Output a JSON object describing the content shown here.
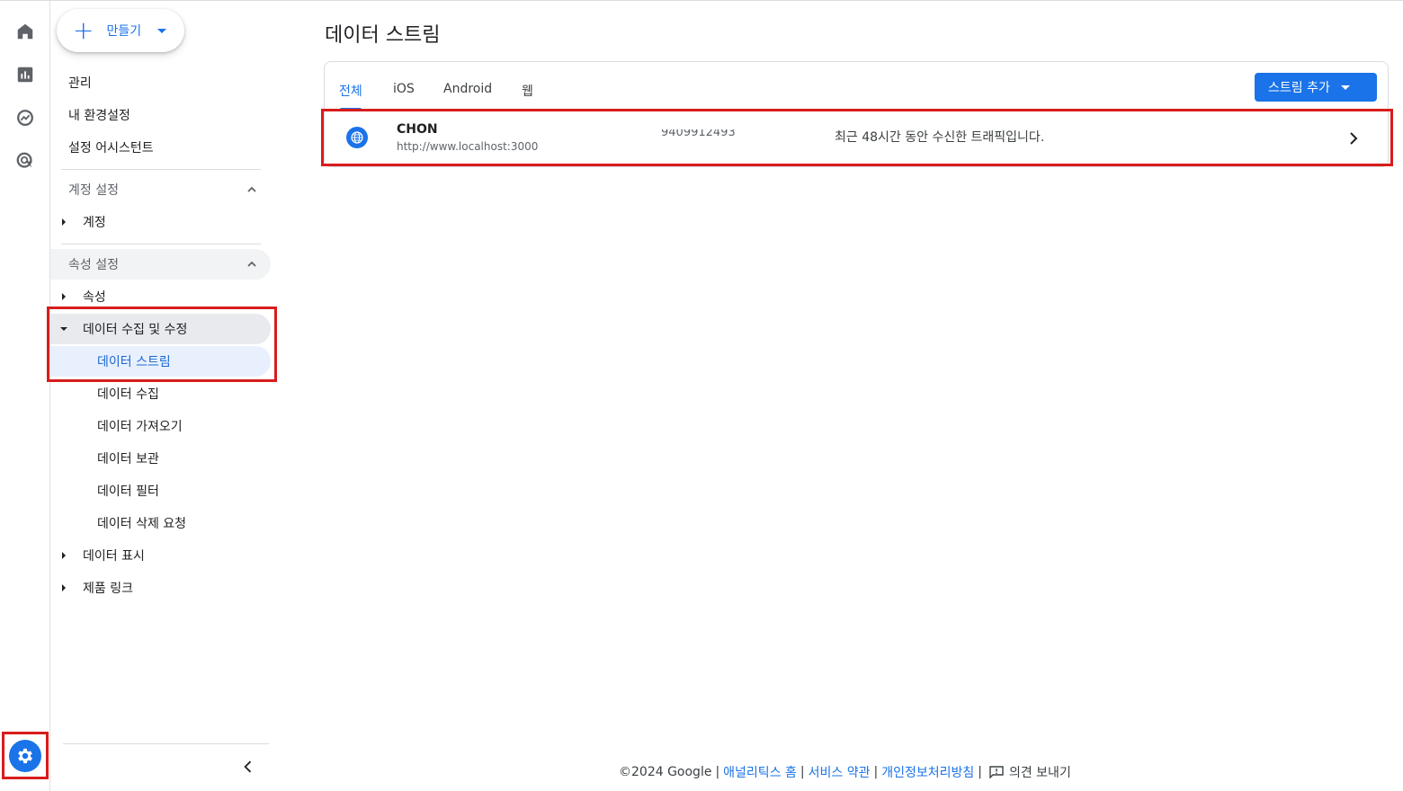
{
  "rail": {
    "icons": [
      "home-icon",
      "reports-icon",
      "explore-icon",
      "advertising-icon",
      "settings-icon"
    ]
  },
  "nav": {
    "create_label": "만들기",
    "admin": "관리",
    "my_settings": "내 환경설정",
    "setup_assistant": "설정 어시스턴트",
    "account_settings": "계정 설정",
    "account": "계정",
    "property_settings": "속성 설정",
    "property": "속성",
    "data_collection_modification": "데이터 수집 및 수정",
    "sub_items": [
      "데이터 스트림",
      "데이터 수집",
      "데이터 가져오기",
      "데이터 보관",
      "데이터 필터",
      "데이터 삭제 요청"
    ],
    "data_display": "데이터 표시",
    "product_links": "제품 링크"
  },
  "main": {
    "title": "데이터 스트림",
    "tabs": [
      "전체",
      "iOS",
      "Android",
      "웹"
    ],
    "active_tab": "전체",
    "add_stream_label": "스트림 추가",
    "streams": [
      {
        "name": "CHON",
        "url": "http://www.localhost:3000",
        "id": "9409912493",
        "status": "최근 48시간 동안 수신한 트래픽입니다."
      }
    ]
  },
  "footer": {
    "copyright": "©2024 Google",
    "analytics_home": "애널리틱스 홈",
    "terms": "서비스 약관",
    "privacy": "개인정보처리방침",
    "feedback": "의견 보내기"
  },
  "colors": {
    "accent": "#1a73e8",
    "highlight_box": "#d81c1c",
    "active_bg": "#e8f0fe"
  }
}
